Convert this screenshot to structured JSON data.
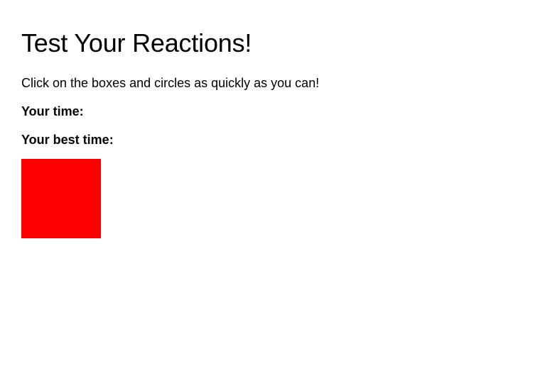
{
  "header": {
    "title": "Test Your Reactions!"
  },
  "instructions": "Click on the boxes and circles as quickly as you can!",
  "stats": {
    "time_label": "Your time:",
    "time_value": "",
    "best_label": "Your best time:",
    "best_value": ""
  },
  "target": {
    "shape": "box",
    "color": "#ff0000"
  }
}
